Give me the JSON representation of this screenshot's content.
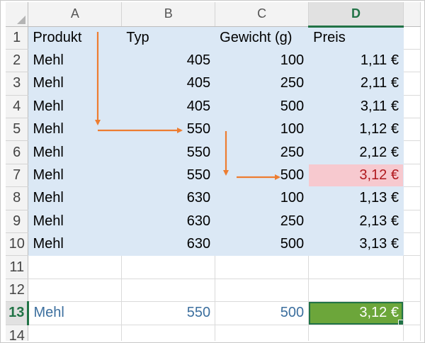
{
  "columns": [
    "A",
    "B",
    "C",
    "D"
  ],
  "active_column": "D",
  "rows": [
    {
      "row": "1",
      "cells": [
        "Produkt",
        "Typ",
        "Gewicht (g)",
        "Preis"
      ]
    },
    {
      "row": "2",
      "cells": [
        "Mehl",
        "405",
        "100",
        "1,11 €"
      ]
    },
    {
      "row": "3",
      "cells": [
        "Mehl",
        "405",
        "250",
        "2,11 €"
      ]
    },
    {
      "row": "4",
      "cells": [
        "Mehl",
        "405",
        "500",
        "3,11 €"
      ]
    },
    {
      "row": "5",
      "cells": [
        "Mehl",
        "550",
        "100",
        "1,12 €"
      ]
    },
    {
      "row": "6",
      "cells": [
        "Mehl",
        "550",
        "250",
        "2,12 €"
      ]
    },
    {
      "row": "7",
      "cells": [
        "Mehl",
        "550",
        "500",
        "3,12 €"
      ]
    },
    {
      "row": "8",
      "cells": [
        "Mehl",
        "630",
        "100",
        "1,13 €"
      ]
    },
    {
      "row": "9",
      "cells": [
        "Mehl",
        "630",
        "250",
        "2,13 €"
      ]
    },
    {
      "row": "10",
      "cells": [
        "Mehl",
        "630",
        "500",
        "3,13 €"
      ]
    },
    {
      "row": "11",
      "cells": [
        "",
        "",
        "",
        ""
      ]
    },
    {
      "row": "12",
      "cells": [
        "",
        "",
        "",
        ""
      ]
    },
    {
      "row": "13",
      "cells": [
        "Mehl",
        "550",
        "500",
        "3,12 €"
      ]
    },
    {
      "row": "14",
      "cells": [
        "",
        "",
        "",
        ""
      ]
    }
  ],
  "active_row": "13",
  "highlighted_cell": "D7",
  "selected_cell": "D13",
  "colors": {
    "table_fill": "#dbe8f5",
    "highlight_fill": "#f7c9cf",
    "highlight_text": "#b0191e",
    "selected_fill": "#6ca63a",
    "excel_green": "#217346",
    "arrow": "#ed7d31",
    "result_text": "#3c6f9e"
  }
}
